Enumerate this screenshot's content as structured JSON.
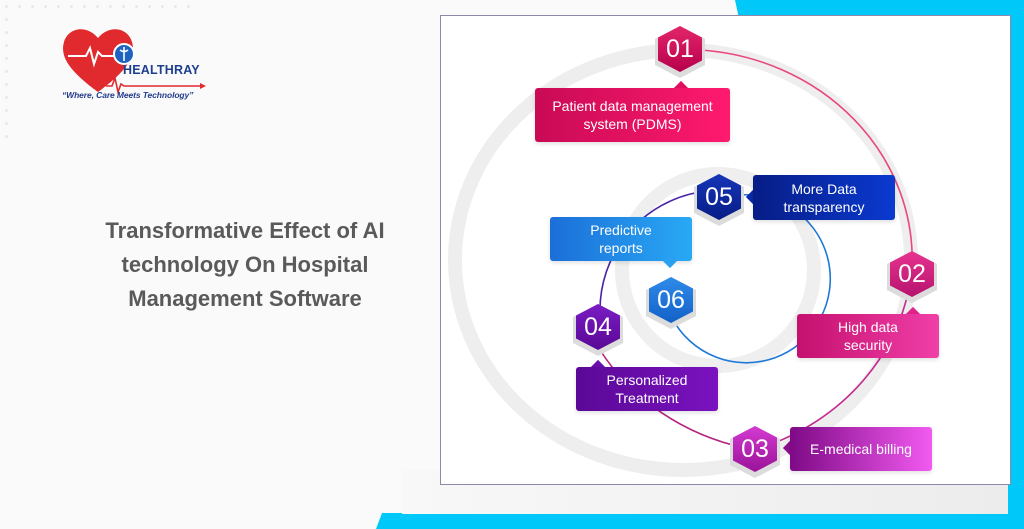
{
  "brand": {
    "name": "HEALTHRAY",
    "tagline": "“Where, Care Meets Technology”",
    "colors": {
      "heart": "#e02a2e",
      "text": "#1d3f8f"
    }
  },
  "headline": {
    "lines": [
      "Transformative Effect of AI",
      "technology On Hospital",
      "Management Software"
    ]
  },
  "diagram": {
    "steps": [
      {
        "number": "01",
        "label_lines": [
          "Patient data management",
          "system (PDMS)"
        ],
        "color": "#e0115f"
      },
      {
        "number": "02",
        "label_lines": [
          "High data",
          "security"
        ],
        "color": "#e1248a"
      },
      {
        "number": "03",
        "label_lines": [
          "E-medical billing"
        ],
        "color": "#c21fb8"
      },
      {
        "number": "04",
        "label_lines": [
          "Personalized",
          "Treatment"
        ],
        "color": "#6a0dad"
      },
      {
        "number": "05",
        "label_lines": [
          "More Data",
          "transparency"
        ],
        "color": "#0a2aa8"
      },
      {
        "number": "06",
        "label_lines": [
          "Predictive",
          "reports"
        ],
        "color": "#1e88e5"
      }
    ]
  },
  "colors": {
    "accent_cyan": "#00c8f8",
    "frame_border": "#8c8aa8"
  }
}
